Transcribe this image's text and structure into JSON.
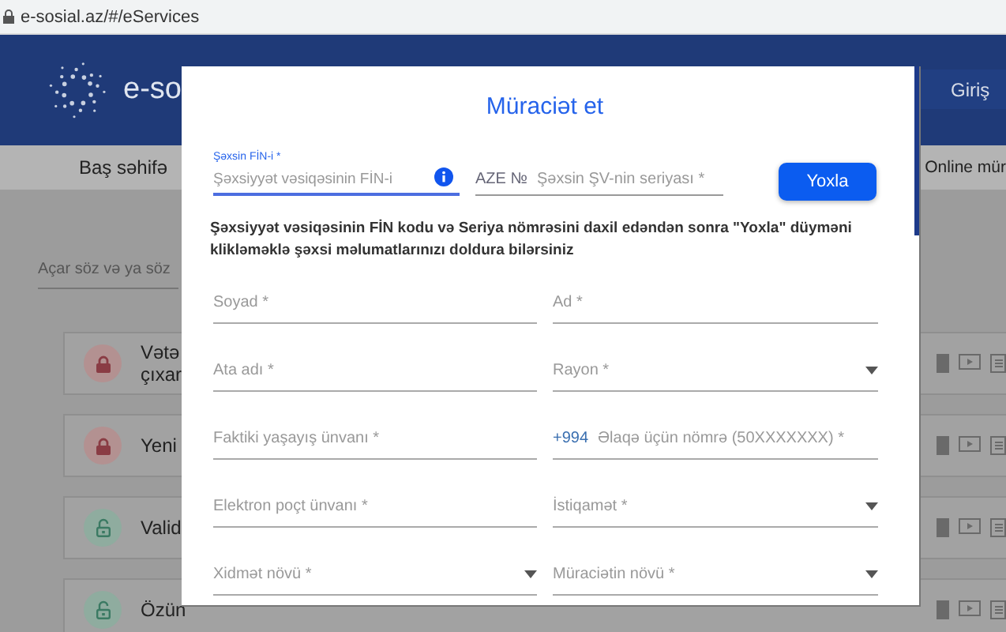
{
  "browser": {
    "url": "e-sosial.az/#/eServices"
  },
  "header": {
    "brand": "e-so",
    "login": "Giriş"
  },
  "nav": {
    "items": [
      "Baş səhifə",
      "Online mür"
    ]
  },
  "search": {
    "placeholder": "Açar söz və ya söz"
  },
  "services": [
    {
      "lines": [
        "Vətə",
        "çıxar"
      ],
      "locked": true
    },
    {
      "lines": [
        "Yeni"
      ],
      "locked": true
    },
    {
      "lines": [
        "Valid"
      ],
      "locked": false
    },
    {
      "lines": [
        "Özün"
      ],
      "locked": false
    }
  ],
  "dialog": {
    "title": "Müraciət et",
    "fin": {
      "label": "Şəxsin FİN-i *",
      "placeholder": "Şəxsiyyət vəsiqəsinin FİN-i"
    },
    "series": {
      "prefix": "AZE №",
      "placeholder": "Şəxsin ŞV-nin seriyası *"
    },
    "check_button": "Yoxla",
    "hint": "Şəxsiyyət vəsiqəsinin FİN kodu və Seriya nömrəsini daxil edəndən sonra \"Yoxla\" düyməni klikləməklə şəxsi məlumatlarınızı doldura bilərsiniz",
    "fields": [
      {
        "kind": "text",
        "placeholder": "Soyad *"
      },
      {
        "kind": "text",
        "placeholder": "Ad *"
      },
      {
        "kind": "text",
        "placeholder": "Ata adı *"
      },
      {
        "kind": "select",
        "label": "Rayon *"
      },
      {
        "kind": "text",
        "placeholder": "Faktiki yaşayış ünvanı *"
      },
      {
        "kind": "phone",
        "prefix": "+994",
        "placeholder": "Əlaqə üçün nömrə (50XXXXXXX) *"
      },
      {
        "kind": "text",
        "placeholder": "Elektron poçt ünvanı *"
      },
      {
        "kind": "select",
        "label": "İstiqamət *"
      },
      {
        "kind": "select",
        "label": "Xidmət növü *"
      },
      {
        "kind": "select",
        "label": "Müraciətin növü *"
      }
    ]
  }
}
